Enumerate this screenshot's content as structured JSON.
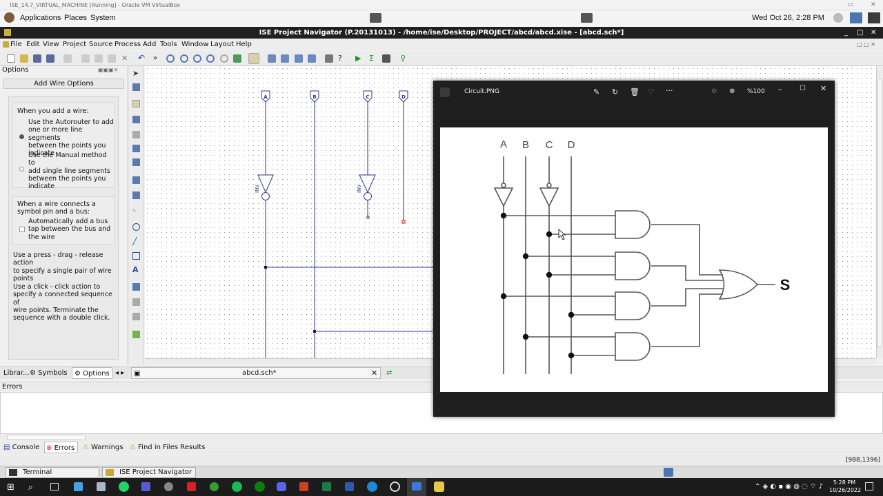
{
  "vbox_title": "ISE_14.7_VIRTUAL_MACHINE [Running] - Oracle VM VirtualBox",
  "gnome": {
    "applications": "Applications",
    "places": "Places",
    "system": "System",
    "clock": "Wed Oct 26,  2:28 PM"
  },
  "window_title": "ISE Project Navigator (P.20131013) - /home/ise/Desktop/PROJECT/abcd/abcd.xise - [abcd.sch*]",
  "menu": [
    "File",
    "Edit",
    "View",
    "Project",
    "Source",
    "Process",
    "Add",
    "Tools",
    "Window",
    "Layout",
    "Help"
  ],
  "options_panel": {
    "header": "Options",
    "button": "Add Wire Options",
    "wire_heading": "When you add a wire:",
    "radio1": [
      "Use the Autorouter to add",
      "one or more line segments",
      "between the points you",
      "indicate"
    ],
    "radio2": [
      "Use the Manual method to",
      "add single line segments",
      "between the points you",
      "indicate"
    ],
    "bus_heading": [
      "When a wire connects a",
      "symbol pin and a bus:"
    ],
    "check1": [
      "Automatically add a bus",
      "tap between the bus and",
      "the wire"
    ],
    "press_drag": [
      "Use a press - drag - release action",
      "to specify a single pair of wire",
      "points"
    ],
    "click_click": [
      "Use a click - click action to",
      "specify a connected sequence of",
      "wire points. Terminate the",
      "sequence with a double click."
    ]
  },
  "schematic": {
    "markers": [
      "A",
      "B",
      "C",
      "D"
    ],
    "inv_label": "INV"
  },
  "tabs": {
    "libraries": "Librar...",
    "symbols": "Symbols",
    "options": "Options",
    "file": "abcd.sch*"
  },
  "errors_header": "Errors",
  "bottom_tabs": [
    "Console",
    "Errors",
    "Warnings",
    "Find in Files Results"
  ],
  "coords": "[988,1396]",
  "gnome_tasks": [
    "Terminal",
    "ISE Project Navigator (P..."
  ],
  "viewer": {
    "title": "Circuit.PNG",
    "zoom": "%100",
    "inputs": [
      "A",
      "B",
      "C",
      "D"
    ],
    "output": "S"
  },
  "win_taskbar": {
    "time": "5:28 PM",
    "date": "10/26/2022"
  }
}
